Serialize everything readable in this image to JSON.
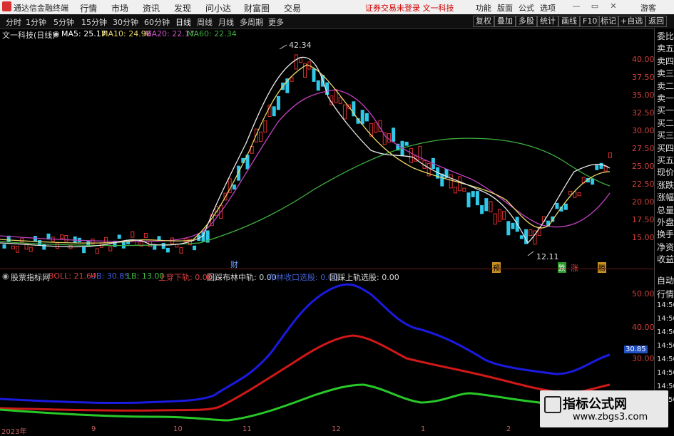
{
  "app": {
    "title": "通达信金融终端"
  },
  "menu": [
    "行情",
    "市场",
    "资讯",
    "发现",
    "问小达",
    "财富圈",
    "交易"
  ],
  "notice": "证券交易未登录  文一科技",
  "top_right": [
    "功能",
    "版面",
    "公式",
    "选项",
    "游客"
  ],
  "periods": [
    "分时",
    "1分钟",
    "5分钟",
    "15分钟",
    "30分钟",
    "60分钟",
    "日线",
    "周线",
    "月线",
    "多周期",
    "更多"
  ],
  "active_period": "日线",
  "right_tools": [
    "复权",
    "叠加",
    "多股",
    "统计",
    "画线",
    "F10",
    "标记",
    "+自选",
    "返回"
  ],
  "stock": {
    "name": "文一科技(日线)"
  },
  "ma_legend": [
    {
      "label": "MA5: 25.17",
      "color": "#ffffff"
    },
    {
      "label": "MA10: 24.96",
      "color": "#e8d66a"
    },
    {
      "label": "MA20: 22.17",
      "color": "#d050d0"
    },
    {
      "label": "MA60: 22.34",
      "color": "#40b040"
    }
  ],
  "price_axis": [
    "40.00",
    "37.50",
    "35.00",
    "32.50",
    "30.00",
    "27.50",
    "25.00",
    "22.50",
    "20.00",
    "17.50",
    "15.00"
  ],
  "annotations": {
    "high": "42.34",
    "low": "12.11",
    "events": [
      "财",
      "预",
      "跌",
      "涨",
      "腾"
    ]
  },
  "indicator_legend": [
    {
      "label": "股票指标网",
      "color": "#d8d8d8"
    },
    {
      "label": "BOLL: 21.64",
      "color": "#d84040"
    },
    {
      "label": "UB: 30.85",
      "color": "#4040e0"
    },
    {
      "label": "LB: 13.00",
      "color": "#40c040"
    },
    {
      "label": "上穿下轨: 0.00",
      "color": "#d84040"
    },
    {
      "label": "回踩布林中轨: 0.00",
      "color": "#d8d8d8"
    },
    {
      "label": "布林收口选股: 0.00",
      "color": "#4060d0"
    },
    {
      "label": "回踩上轨选股: 0.00",
      "color": "#d8d8d8"
    }
  ],
  "indicator_axis": [
    "50.00",
    "40.00",
    "30.00"
  ],
  "indicator_current": "30.85",
  "right_panel_top": [
    "委比",
    "卖五",
    "卖四",
    "卖三",
    "卖二",
    "卖一",
    "买一",
    "买二",
    "买三",
    "买四",
    "买五",
    "现价",
    "涨跌",
    "涨幅",
    "总量",
    "外盘",
    "换手",
    "净资",
    "收益"
  ],
  "right_panel_bottom": [
    "自动",
    "行情",
    "14:50",
    "14:50",
    "14:50",
    "14:50",
    "14:50",
    "14:50",
    "14:50",
    "14:50"
  ],
  "time_axis": [
    "2023年",
    "9",
    "10",
    "11",
    "12",
    "1",
    "2"
  ],
  "watermark": {
    "title": "指标公式网",
    "url": "www.zbgs3.com"
  }
}
